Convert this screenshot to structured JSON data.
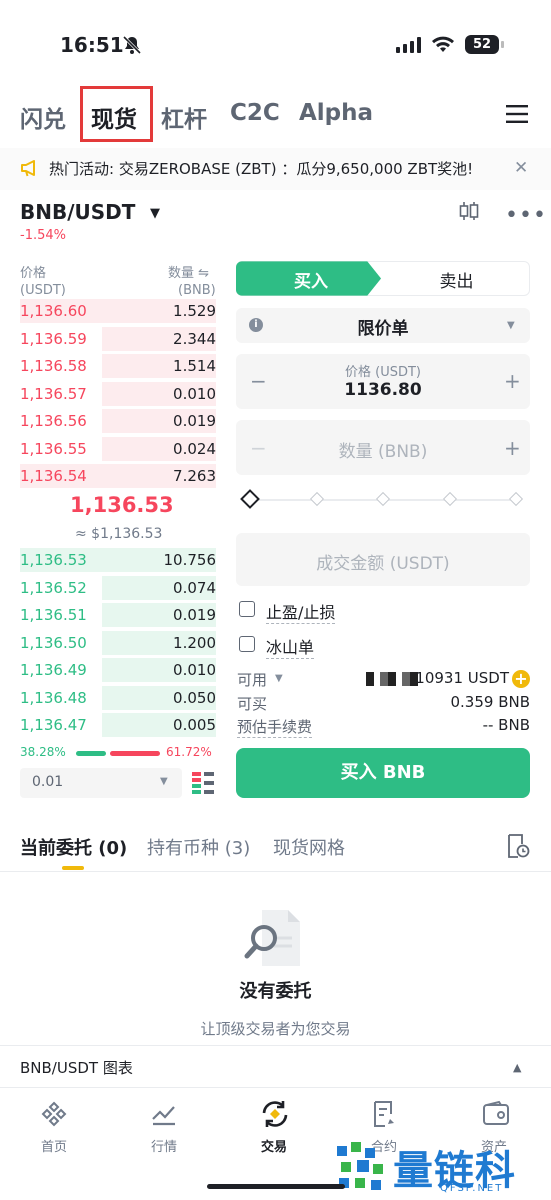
{
  "status_bar": {
    "time": "16:51",
    "battery": "52"
  },
  "top_tabs": [
    "闪兑",
    "现货",
    "杠杆",
    "C2C",
    "Alpha"
  ],
  "announcement": "热门活动: 交易ZEROBASE (ZBT) ：瓜分9,650,000 ZBT奖池!",
  "pair": {
    "name": "BNB/USDT",
    "change": "-1.54%"
  },
  "order_book": {
    "price_header": "价格",
    "price_unit": "(USDT)",
    "qty_header": "数量 ⇋",
    "qty_unit": "(BNB)",
    "asks": [
      {
        "price": "1,136.60",
        "qty": "1.529",
        "depth": 1.0
      },
      {
        "price": "1,136.59",
        "qty": "2.344",
        "depth": 0.58
      },
      {
        "price": "1,136.58",
        "qty": "1.514",
        "depth": 0.58
      },
      {
        "price": "1,136.57",
        "qty": "0.010",
        "depth": 0.58
      },
      {
        "price": "1,136.56",
        "qty": "0.019",
        "depth": 0.58
      },
      {
        "price": "1,136.55",
        "qty": "0.024",
        "depth": 0.58
      },
      {
        "price": "1,136.54",
        "qty": "7.263",
        "depth": 1.0
      }
    ],
    "last_price": "1,136.53",
    "last_price_usd": "≈ $1,136.53",
    "bids": [
      {
        "price": "1,136.53",
        "qty": "10.756",
        "depth": 1.0
      },
      {
        "price": "1,136.52",
        "qty": "0.074",
        "depth": 0.58
      },
      {
        "price": "1,136.51",
        "qty": "0.019",
        "depth": 0.58
      },
      {
        "price": "1,136.50",
        "qty": "1.200",
        "depth": 0.58
      },
      {
        "price": "1,136.49",
        "qty": "0.010",
        "depth": 0.58
      },
      {
        "price": "1,136.48",
        "qty": "0.050",
        "depth": 0.58
      },
      {
        "price": "1,136.47",
        "qty": "0.005",
        "depth": 0.58
      }
    ],
    "buy_ratio": "38.28%",
    "sell_ratio": "61.72%",
    "precision": "0.01"
  },
  "order_form": {
    "buy_label": "买入",
    "sell_label": "卖出",
    "order_type": "限价单",
    "price_label": "价格 (USDT)",
    "price_value": "1136.80",
    "qty_placeholder": "数量 (BNB)",
    "amount_placeholder": "成交金额 (USDT)",
    "tpsl_label": "止盈/止损",
    "iceberg_label": "冰山单",
    "available_label": "可用",
    "available_value": "10931 USDT",
    "can_buy_label": "可买",
    "can_buy_value": "0.359 BNB",
    "fee_label": "预估手续费",
    "fee_value": "-- BNB",
    "buy_button": "买入 BNB"
  },
  "orders_tabs": [
    "当前委托 (0)",
    "持有币种 (3)",
    "现货网格"
  ],
  "empty_state": {
    "title": "没有委托",
    "subtitle": "让顶级交易者为您交易"
  },
  "chart_bar": "BNB/USDT 图表",
  "bottom_nav": [
    "首页",
    "行情",
    "交易",
    "合约",
    "资产"
  ],
  "watermark": {
    "text": "量链科技",
    "sub": "QFSP.NET"
  },
  "colors": {
    "buy": "#2ebd85",
    "sell": "#f6465d",
    "accent": "#f0b90b"
  }
}
